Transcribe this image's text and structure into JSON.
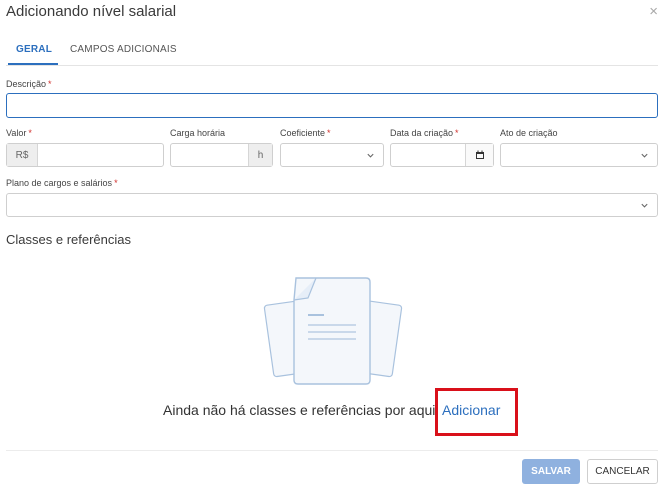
{
  "dialog": {
    "title": "Adicionando nível salarial",
    "close_icon": "×"
  },
  "tabs": [
    {
      "label": "GERAL",
      "active": true
    },
    {
      "label": "CAMPOS ADICIONAIS",
      "active": false
    }
  ],
  "form": {
    "descricao": {
      "label": "Descrição",
      "required": "*",
      "value": ""
    },
    "valor": {
      "label": "Valor",
      "required": "*",
      "prefix": "R$",
      "value": ""
    },
    "carga": {
      "label": "Carga horária",
      "suffix": "h",
      "value": ""
    },
    "coeficiente": {
      "label": "Coeficiente",
      "required": "*",
      "value": ""
    },
    "data": {
      "label": "Data da criação",
      "required": "*",
      "value": ""
    },
    "ato": {
      "label": "Ato de criação",
      "value": ""
    },
    "plano": {
      "label": "Plano de cargos e salários",
      "required": "*",
      "value": ""
    }
  },
  "section": {
    "title": "Classes e referências",
    "empty_text": "Ainda não há classes e referências por aqui",
    "add_link": "Adicionar"
  },
  "footer": {
    "save_label": "SALVAR",
    "cancel_label": "CANCELAR"
  },
  "icons": {
    "chevron": "chevron-down-icon",
    "calendar": "calendar-icon",
    "close": "close-icon"
  }
}
